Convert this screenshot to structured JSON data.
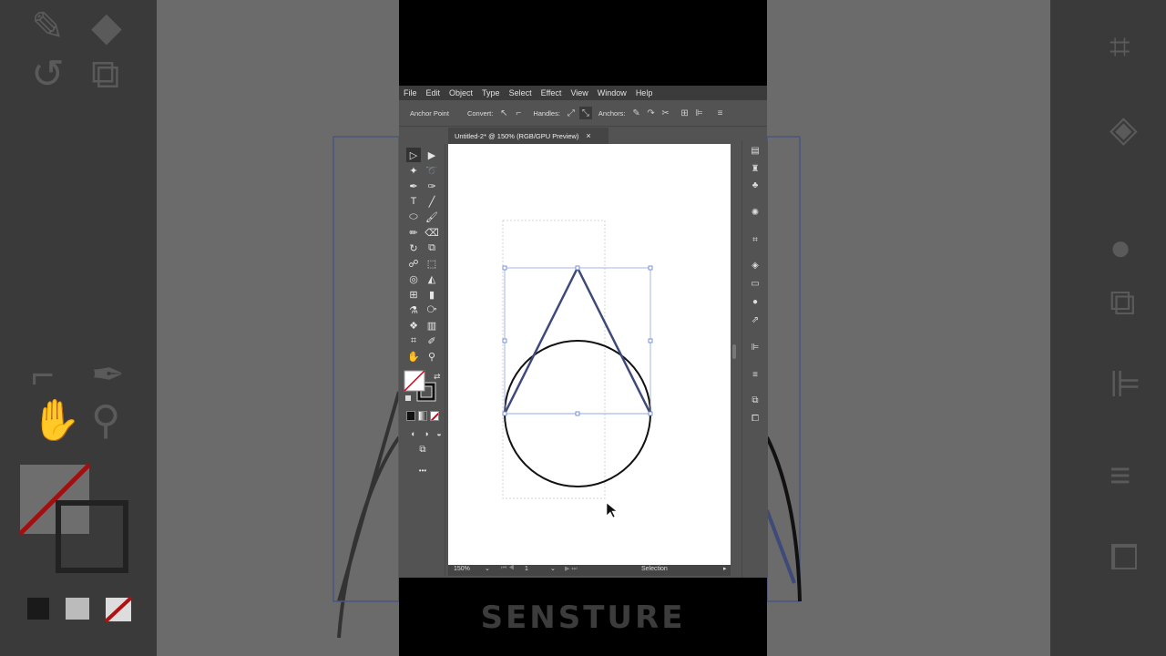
{
  "menu": [
    "File",
    "Edit",
    "Object",
    "Type",
    "Select",
    "Effect",
    "View",
    "Window",
    "Help"
  ],
  "control_bar": {
    "tool_name": "Anchor Point",
    "convert_label": "Convert:",
    "handles_label": "Handles:",
    "anchors_label": "Anchors:"
  },
  "document_tab": {
    "title": "Untitled-2* @ 150% (RGB/GPU Preview)",
    "close": "×"
  },
  "status": {
    "zoom": "150%",
    "artboard": "1",
    "tool": "Selection"
  },
  "watermark": "SENSTURE",
  "icons": {
    "direct_selection": "▷",
    "selection": "▶",
    "type": "T",
    "zoom": "⚲",
    "hand": "✋",
    "more": "•••"
  },
  "colors": {
    "accent_path": "#3e4a78",
    "bounding_box": "#6f8fd8",
    "fill_none_red": "#d0021b"
  }
}
